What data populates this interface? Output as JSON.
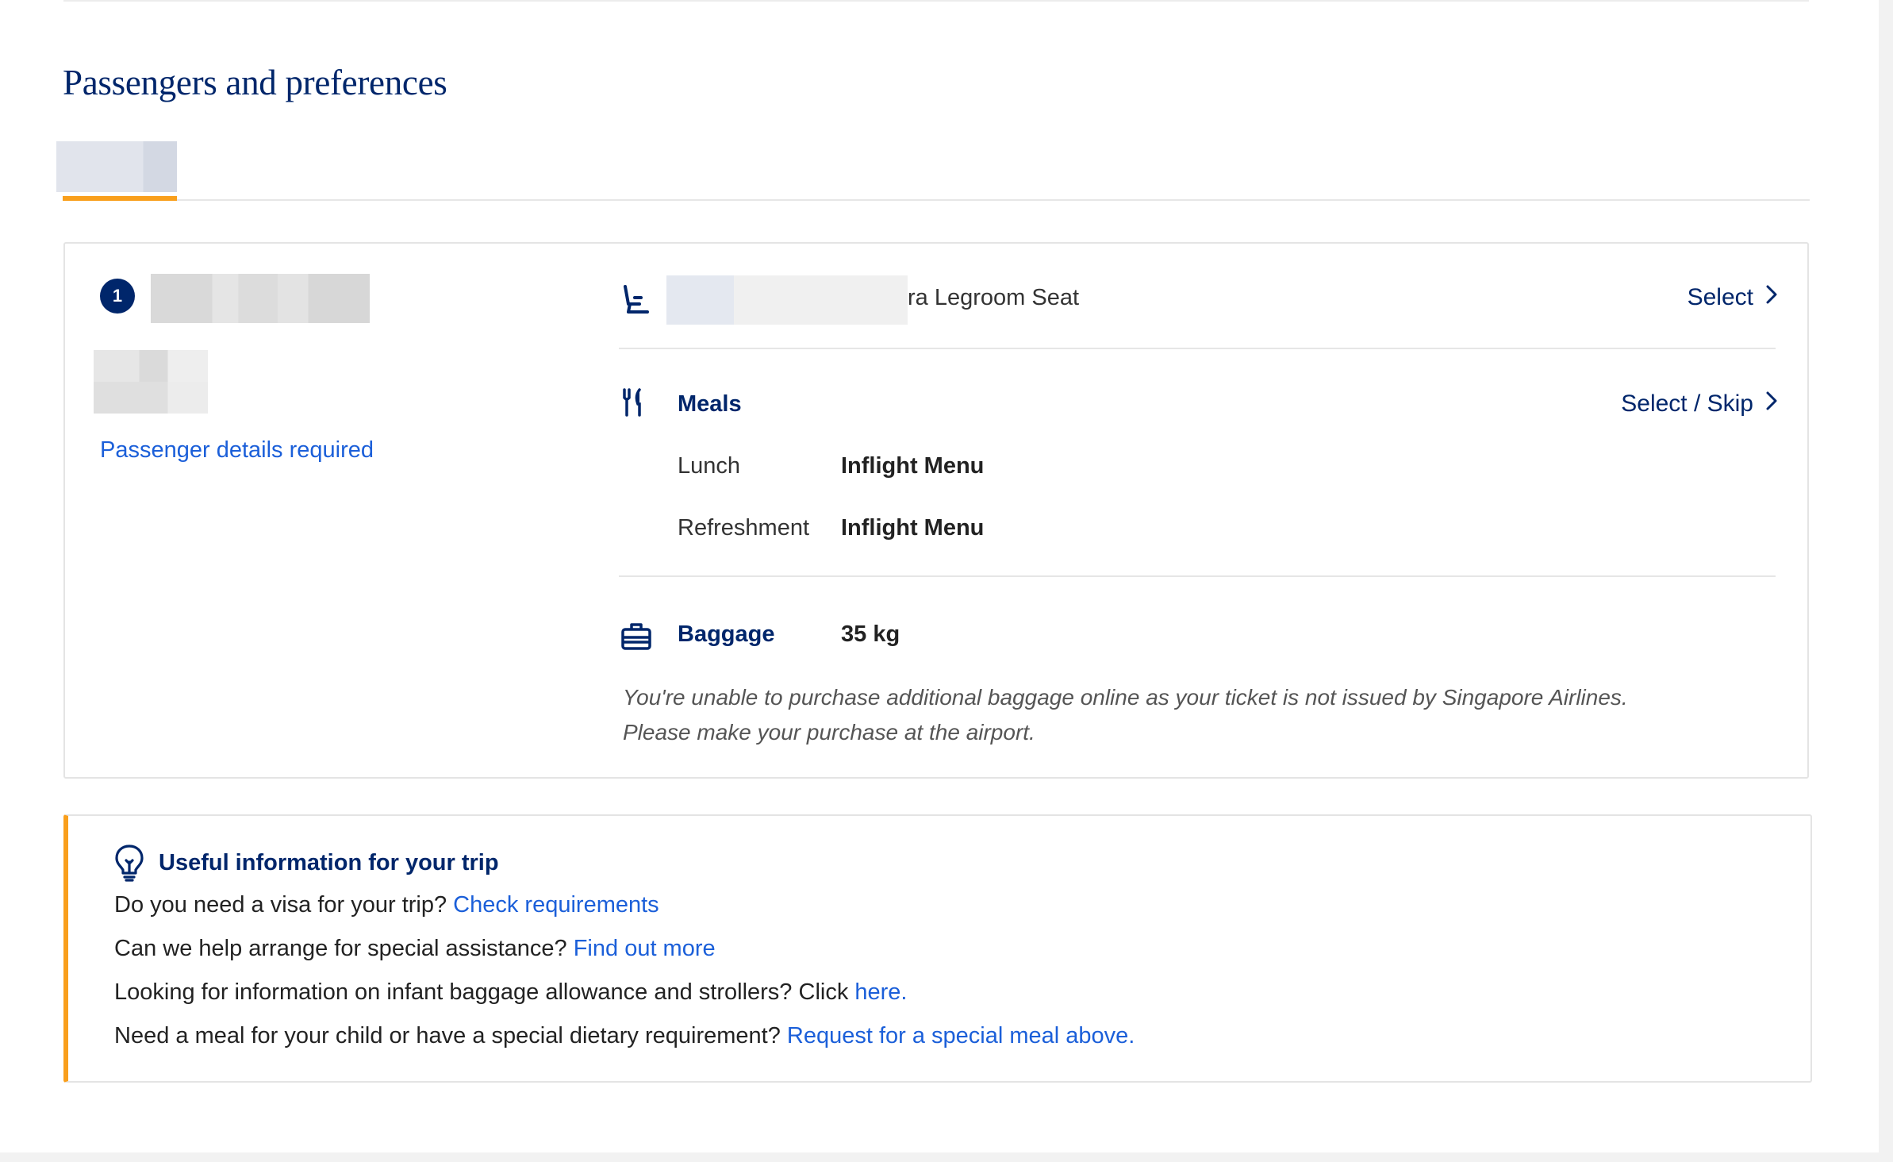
{
  "page": {
    "title": "Passengers and preferences"
  },
  "passenger": {
    "number": "1",
    "details_link": "Passenger details required"
  },
  "seat": {
    "icon": "seat-icon",
    "label_visible": "ra Legroom Seat",
    "action": "Select"
  },
  "meals": {
    "icon": "fork-knife-icon",
    "label": "Meals",
    "action": "Select / Skip",
    "items": [
      {
        "name": "Lunch",
        "value": "Inflight Menu"
      },
      {
        "name": "Refreshment",
        "value": "Inflight Menu"
      }
    ]
  },
  "baggage": {
    "icon": "suitcase-icon",
    "label": "Baggage",
    "value": "35 kg",
    "note_line1": "You're unable to purchase additional baggage online as your ticket is not issued by Singapore Airlines.",
    "note_line2": "Please make your purchase at the airport."
  },
  "useful_info": {
    "icon": "lightbulb-icon",
    "title": "Useful information for your trip",
    "lines": [
      {
        "text": "Do you need a visa for your trip? ",
        "link": "Check requirements"
      },
      {
        "text": "Can we help arrange for special assistance? ",
        "link": "Find out more"
      },
      {
        "text": "Looking for information on infant baggage allowance and strollers? Click ",
        "link": "here."
      },
      {
        "text": "Need a meal for your child or have a special dietary requirement? ",
        "link": "Request for a special meal above."
      }
    ]
  },
  "colors": {
    "brand_navy": "#00266b",
    "link_blue": "#1b5fd9",
    "accent_orange": "#f99f1c"
  }
}
